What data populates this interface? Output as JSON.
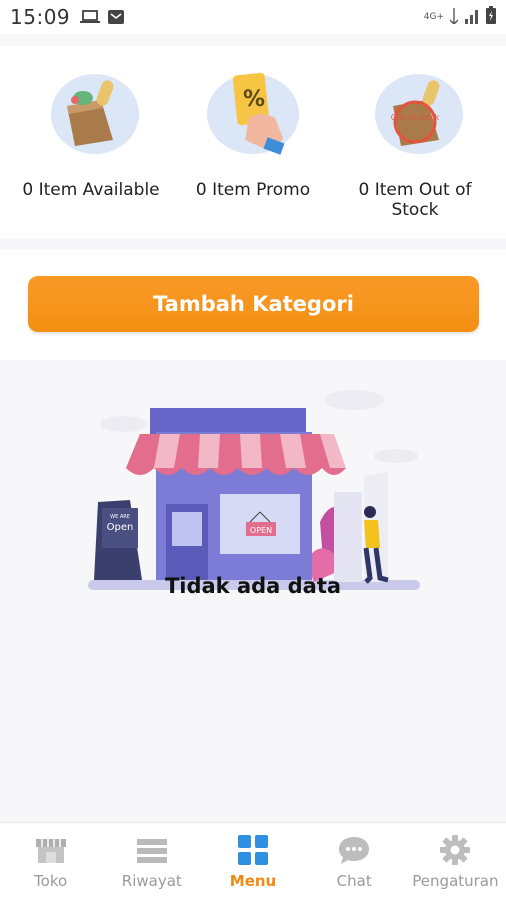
{
  "status_bar": {
    "time": "15:09",
    "network": "4G+"
  },
  "summary": {
    "items": [
      {
        "label": "0 Item Available",
        "icon": "grocery-bag-icon"
      },
      {
        "label": "0 Item Promo",
        "icon": "promo-card-icon"
      },
      {
        "label": "0 Item Out of Stock",
        "icon": "out-of-stock-icon",
        "badge": "Out of stock"
      }
    ]
  },
  "actions": {
    "add_category_label": "Tambah Kategori"
  },
  "empty_state": {
    "message": "Tidak ada data",
    "sign_small": "WE ARE",
    "sign_open": "Open",
    "door_sign": "OPEN"
  },
  "bottom_nav": {
    "items": [
      {
        "label": "Toko",
        "icon": "store-icon",
        "active": false
      },
      {
        "label": "Riwayat",
        "icon": "history-icon",
        "active": false
      },
      {
        "label": "Menu",
        "icon": "menu-grid-icon",
        "active": true
      },
      {
        "label": "Chat",
        "icon": "chat-icon",
        "active": false
      },
      {
        "label": "Pengaturan",
        "icon": "gear-icon",
        "active": false
      }
    ]
  },
  "colors": {
    "accent": "#f39013",
    "nav_active": "#2f8fe0",
    "awning_pink": "#e26d8c",
    "store_purple": "#6f6fd0"
  }
}
